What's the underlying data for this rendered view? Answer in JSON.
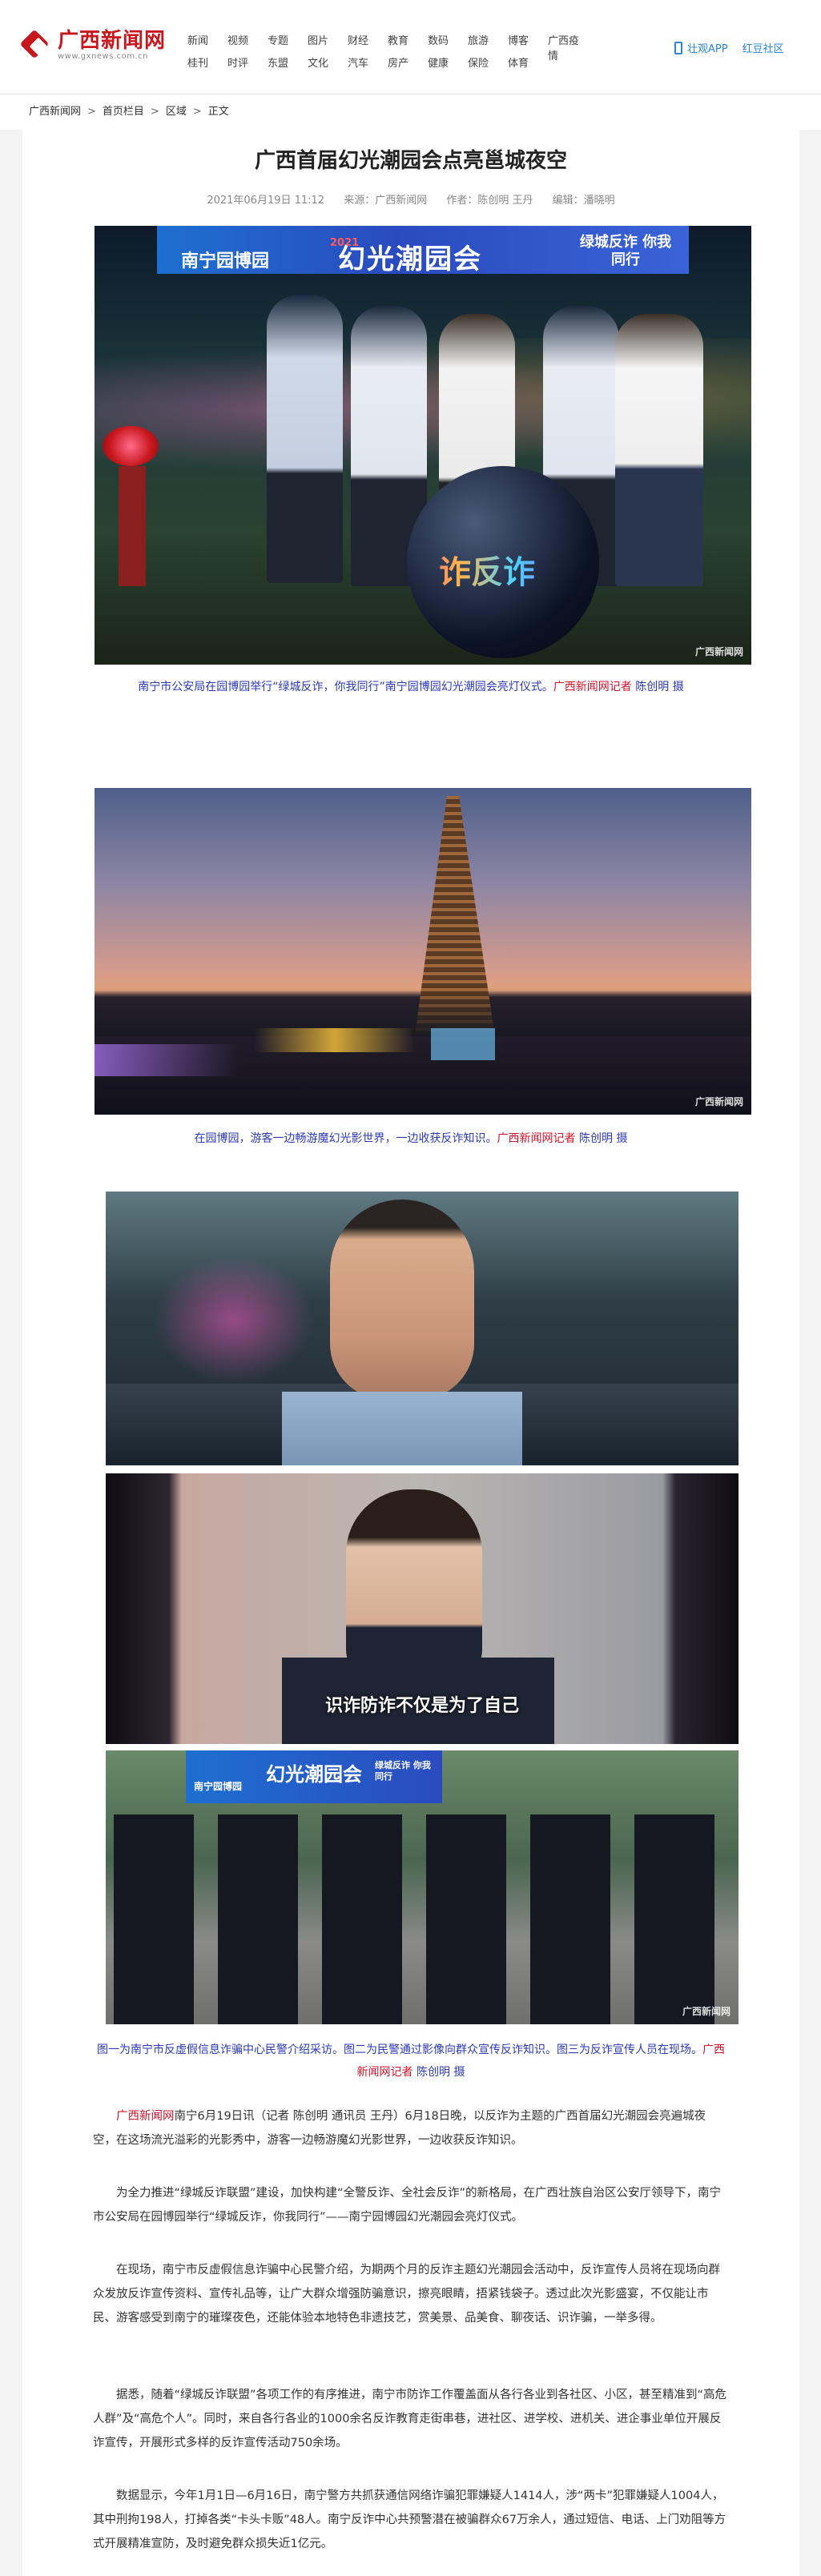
{
  "site": {
    "logo_cn": "广西新闻网",
    "logo_en": "www.gxnews.com.cn"
  },
  "nav": [
    "新闻",
    "视频",
    "专题",
    "图片",
    "财经",
    "教育",
    "数码",
    "旅游",
    "博客",
    "广西疫情",
    "桂刊",
    "时评",
    "东盟",
    "文化",
    "汽车",
    "房产",
    "健康",
    "保险",
    "体育",
    ""
  ],
  "header_right": {
    "app": "壮观APP",
    "community": "红豆社区"
  },
  "breadcrumb": [
    "广西新闻网",
    "首页栏目",
    "区域",
    "正文"
  ],
  "article": {
    "title": "广西首届幻光潮园会点亮邕城夜空",
    "date": "2021年06月19日 11:12",
    "source": "来源：广西新闻网",
    "author": "作者：陈创明 王丹",
    "editor": "编辑：潘晓明"
  },
  "images": {
    "img1_banner_left": "南宁园博园",
    "img1_banner_mid": "幻光潮园会",
    "img1_banner_year": "2021",
    "img1_banner_right": "绿城反诈 你我同行",
    "img1_ball_text": "诈反诈",
    "img3_caption_text": "识诈防诈不仅是为了自己",
    "img4_banner_left": "南宁园博园",
    "img4_banner_mid": "幻光潮园会",
    "img4_banner_right": "绿城反诈 你我同行",
    "watermark": "广西新闻网"
  },
  "captions": {
    "c1_blue": "南宁市公安局在园博园举行“绿城反诈，你我同行”南宁园博园幻光潮园会亮灯仪式。",
    "c1_red": "广西新闻网记者",
    "c1_tail": " 陈创明 摄",
    "c2_blue": "在园博园，游客一边畅游魔幻光影世界，一边收获反诈知识。",
    "c2_red": "广西新闻网记者",
    "c2_tail": " 陈创明 摄",
    "c3_blue": "图一为南宁市反虚假信息诈骗中心民警介绍采访。图二为民警通过影像向群众宣传反诈知识。图三为反诈宣传人员在现场。",
    "c3_red": "广西新闻网记者",
    "c3_tail": " 陈创明 摄"
  },
  "paragraphs": {
    "p1_red": "广西新闻网",
    "p1": "南宁6月19日讯（记者 陈创明 通讯员 王丹）6月18日晚，以反诈为主题的广西首届幻光潮园会亮遍城夜空，在这场流光溢彩的光影秀中，游客一边畅游魔幻光影世界，一边收获反诈知识。",
    "p2": "为全力推进“绿城反诈联盟”建设，加快构建“全警反诈、全社会反诈”的新格局，在广西壮族自治区公安厅领导下，南宁市公安局在园博园举行“绿城反诈，你我同行”——南宁园博园幻光潮园会亮灯仪式。",
    "p3": "在现场，南宁市反虚假信息诈骗中心民警介绍，为期两个月的反诈主题幻光潮园会活动中，反诈宣传人员将在现场向群众发放反诈宣传资料、宣传礼品等，让广大群众增强防骗意识，擦亮眼睛，捂紧钱袋子。透过此次光影盛宴，不仅能让市民、游客感受到南宁的璀璨夜色，还能体验本地特色非遗技艺，赏美景、品美食、聊夜话、识诈骗，一举多得。",
    "p4": "据悉，随着“绿城反诈联盟”各项工作的有序推进，南宁市防诈工作覆盖面从各行各业到各社区、小区，甚至精准到“高危人群”及“高危个人”。同时，来自各行各业的1000余名反诈教育走街串巷，进社区、进学校、进机关、进企事业单位开展反诈宣传，开展形式多样的反诈宣传活动750余场。",
    "p5": "数据显示，今年1月1日—6月16日，南宁警方共抓获通信网络诈骗犯罪嫌疑人1414人，涉“两卡”犯罪嫌疑人1004人，其中刑拘198人，打掉各类“卡头卡贩”48人。南宁反诈中心共预警潜在被骗群众67万余人，通过短信、电话、上门劝阻等方式开展精准宣防，及时避免群众损失近1亿元。"
  },
  "colors": {
    "brand_red": "#c8161d",
    "caption_blue": "#2d3ab3",
    "caption_red": "#d0142c",
    "link_blue": "#2a86d6"
  }
}
